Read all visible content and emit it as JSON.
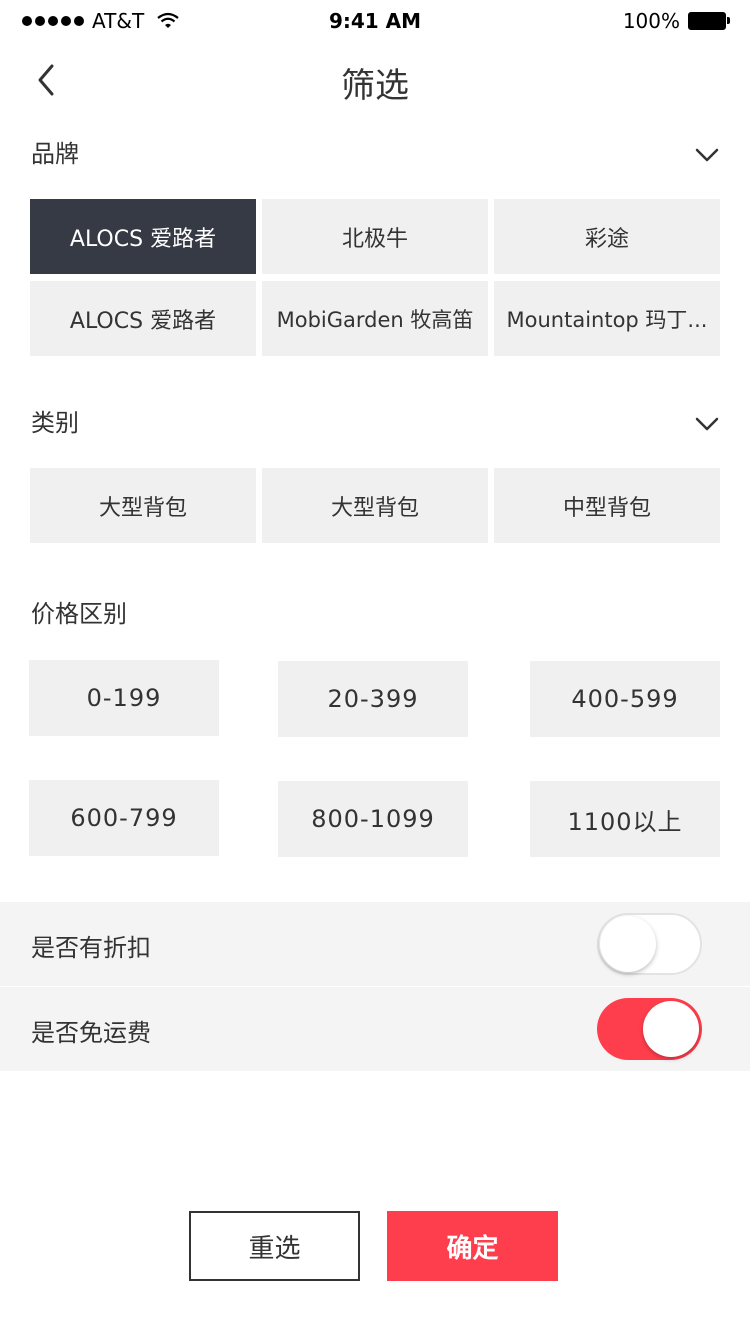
{
  "status_bar": {
    "carrier": "AT&T",
    "time": "9:41 AM",
    "battery": "100%"
  },
  "header": {
    "title": "筛选"
  },
  "brand": {
    "title": "品牌",
    "items": [
      {
        "label": "ALOCS  爱路者",
        "selected": true
      },
      {
        "label": "北极牛"
      },
      {
        "label": "彩途"
      },
      {
        "label": "ALOCS  爱路者"
      },
      {
        "label": "MobiGarden 牧高笛"
      },
      {
        "label": "Mountaintop 玛丁..."
      }
    ]
  },
  "category": {
    "title": "类别",
    "items": [
      {
        "label": "大型背包"
      },
      {
        "label": "大型背包"
      },
      {
        "label": "中型背包"
      }
    ]
  },
  "price": {
    "title": "价格区别",
    "items": [
      {
        "label": "0-199"
      },
      {
        "label": "20-399"
      },
      {
        "label": "400-599"
      },
      {
        "label": "600-799"
      },
      {
        "label": "800-1099"
      },
      {
        "label": "1100以上"
      }
    ]
  },
  "toggles": {
    "discount": {
      "label": "是否有折扣",
      "on": false
    },
    "free_shipping": {
      "label": "是否免运费",
      "on": true
    }
  },
  "actions": {
    "reset": "重选",
    "confirm": "确定"
  },
  "colors": {
    "accent": "#ff3e4d",
    "selected_chip": "#353a44",
    "chip_bg": "#f0f0f0"
  }
}
